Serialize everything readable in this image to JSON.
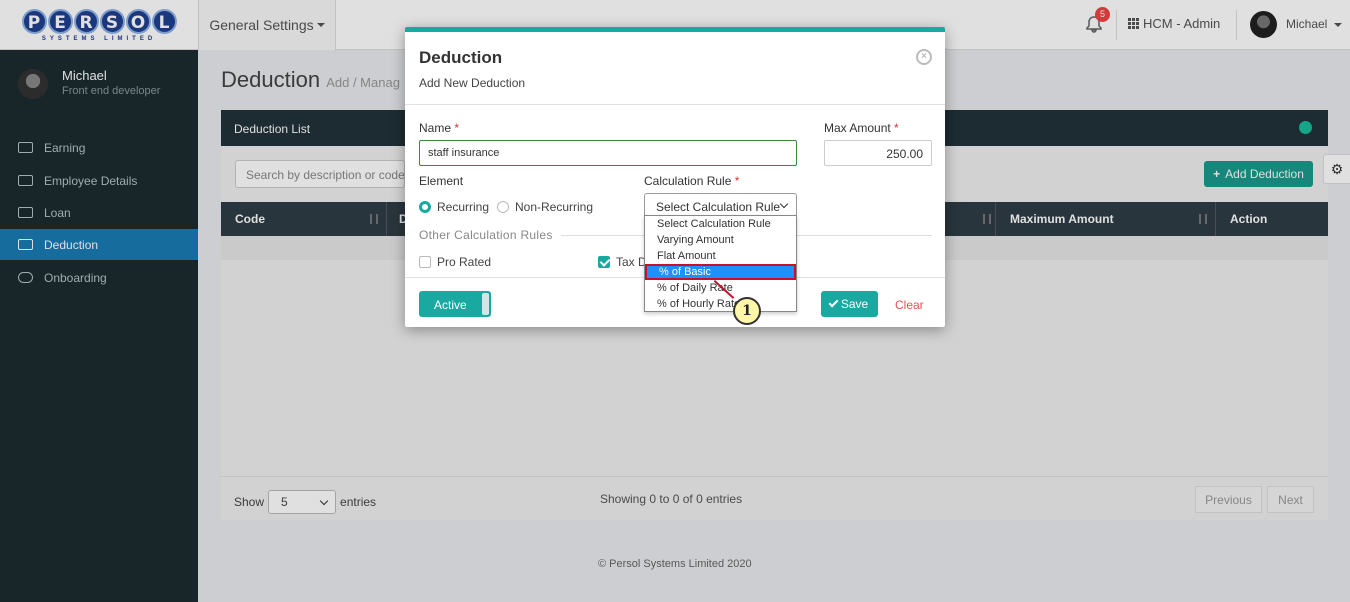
{
  "topbar": {
    "logo_letters": [
      "P",
      "E",
      "R",
      "S",
      "O",
      "L"
    ],
    "logo_sub": "SYSTEMS LIMITED",
    "general_settings": "General Settings",
    "notification_count": "5",
    "app_name": "HCM - Admin",
    "user_name": "Michael"
  },
  "sidebar": {
    "user_name": "Michael",
    "user_role": "Front end developer",
    "items": [
      {
        "label": "Earning",
        "icon": "money-icon"
      },
      {
        "label": "Employee Details",
        "icon": "id-card-icon"
      },
      {
        "label": "Loan",
        "icon": "loan-icon"
      },
      {
        "label": "Deduction",
        "icon": "deduction-icon",
        "active": true
      },
      {
        "label": "Onboarding",
        "icon": "cloud-upload-icon"
      }
    ]
  },
  "page": {
    "title": "Deduction",
    "subtitle": "Add / Manag"
  },
  "card": {
    "header": "Deduction List",
    "search_placeholder": "Search by description or code or",
    "add_button": "Add Deduction",
    "columns": [
      "Code",
      "D",
      "Maximum Amount",
      "Action"
    ],
    "show_label": "Show",
    "show_value": "5",
    "entries_label": "entries",
    "showing_text": "Showing 0 to 0 of 0 entries",
    "previous": "Previous",
    "next": "Next"
  },
  "footer": "© Persol Systems Limited 2020",
  "modal": {
    "title": "Deduction",
    "subtitle": "Add New Deduction",
    "name_label": "Name",
    "name_value": "staff insurance",
    "max_label": "Max Amount",
    "max_value": "250.00",
    "element_label": "Element",
    "recurring": "Recurring",
    "non_recurring": "Non-Recurring",
    "calc_label": "Calculation Rule",
    "calc_selected": "Select Calculation Rule",
    "other_rules": "Other Calculation Rules",
    "pro_rated": "Pro Rated",
    "tax_label": "Tax D",
    "active": "Active",
    "save": "Save",
    "clear": "Clear",
    "required_mark": "*"
  },
  "dropdown": {
    "options": [
      "Select Calculation Rule",
      "Varying Amount",
      "Flat Amount",
      "% of Basic",
      "% of Daily Rate",
      "% of Hourly Rate"
    ],
    "highlighted": "% of Basic"
  },
  "callout": "1",
  "colors": {
    "accent": "#1aa9a0",
    "sidebar": "#1c2b2f",
    "highlight": "#1e90ff",
    "marker": "#c8102e"
  }
}
